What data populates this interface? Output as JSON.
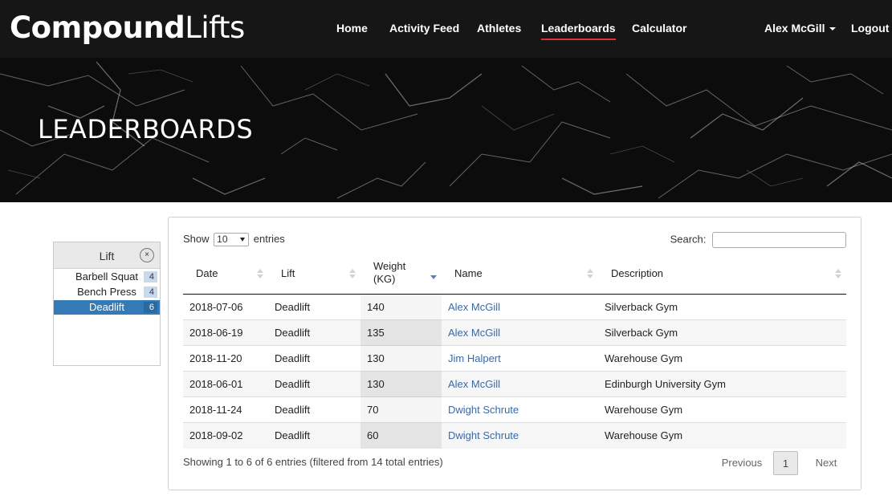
{
  "navbar": {
    "brand_bold": "Compound",
    "brand_light": "Lifts",
    "links": [
      {
        "label": "Home",
        "active": false
      },
      {
        "label": "Activity Feed",
        "active": false
      },
      {
        "label": "Athletes",
        "active": false
      },
      {
        "label": "Leaderboards",
        "active": true
      },
      {
        "label": "Calculator",
        "active": false
      }
    ],
    "user_menu": "Alex McGill",
    "logout": "Logout",
    "accent_color": "#e0303a"
  },
  "hero": {
    "title": "LEADERBOARDS"
  },
  "filter": {
    "title": "Lift",
    "clear_icon": "×",
    "items": [
      {
        "label": "Barbell Squat",
        "count": "4",
        "selected": false
      },
      {
        "label": "Bench Press",
        "count": "4",
        "selected": false
      },
      {
        "label": "Deadlift",
        "count": "6",
        "selected": true
      }
    ],
    "selected_color": "#337ab7"
  },
  "table_controls": {
    "show_label": "Show",
    "page_size": "10",
    "entries_label": "entries",
    "search_label": "Search:",
    "search_value": ""
  },
  "table": {
    "columns": [
      {
        "label": "Date",
        "sort": "none"
      },
      {
        "label": "Lift",
        "sort": "none"
      },
      {
        "label": "Weight (KG)",
        "sort": "desc"
      },
      {
        "label": "Name",
        "sort": "none"
      },
      {
        "label": "Description",
        "sort": "none"
      }
    ],
    "rows": [
      {
        "date": "2018-07-06",
        "lift": "Deadlift",
        "weight": "140",
        "name": "Alex McGill",
        "description": "Silverback Gym"
      },
      {
        "date": "2018-06-19",
        "lift": "Deadlift",
        "weight": "135",
        "name": "Alex McGill",
        "description": "Silverback Gym"
      },
      {
        "date": "2018-11-20",
        "lift": "Deadlift",
        "weight": "130",
        "name": "Jim Halpert",
        "description": "Warehouse Gym"
      },
      {
        "date": "2018-06-01",
        "lift": "Deadlift",
        "weight": "130",
        "name": "Alex McGill",
        "description": "Edinburgh University Gym"
      },
      {
        "date": "2018-11-24",
        "lift": "Deadlift",
        "weight": "70",
        "name": "Dwight Schrute",
        "description": "Warehouse Gym"
      },
      {
        "date": "2018-09-02",
        "lift": "Deadlift",
        "weight": "60",
        "name": "Dwight Schrute",
        "description": "Warehouse Gym"
      }
    ],
    "link_color": "#3a6aa6"
  },
  "footer": {
    "info": "Showing 1 to 6 of 6 entries (filtered from 14 total entries)",
    "previous": "Previous",
    "current_page": "1",
    "next": "Next"
  }
}
